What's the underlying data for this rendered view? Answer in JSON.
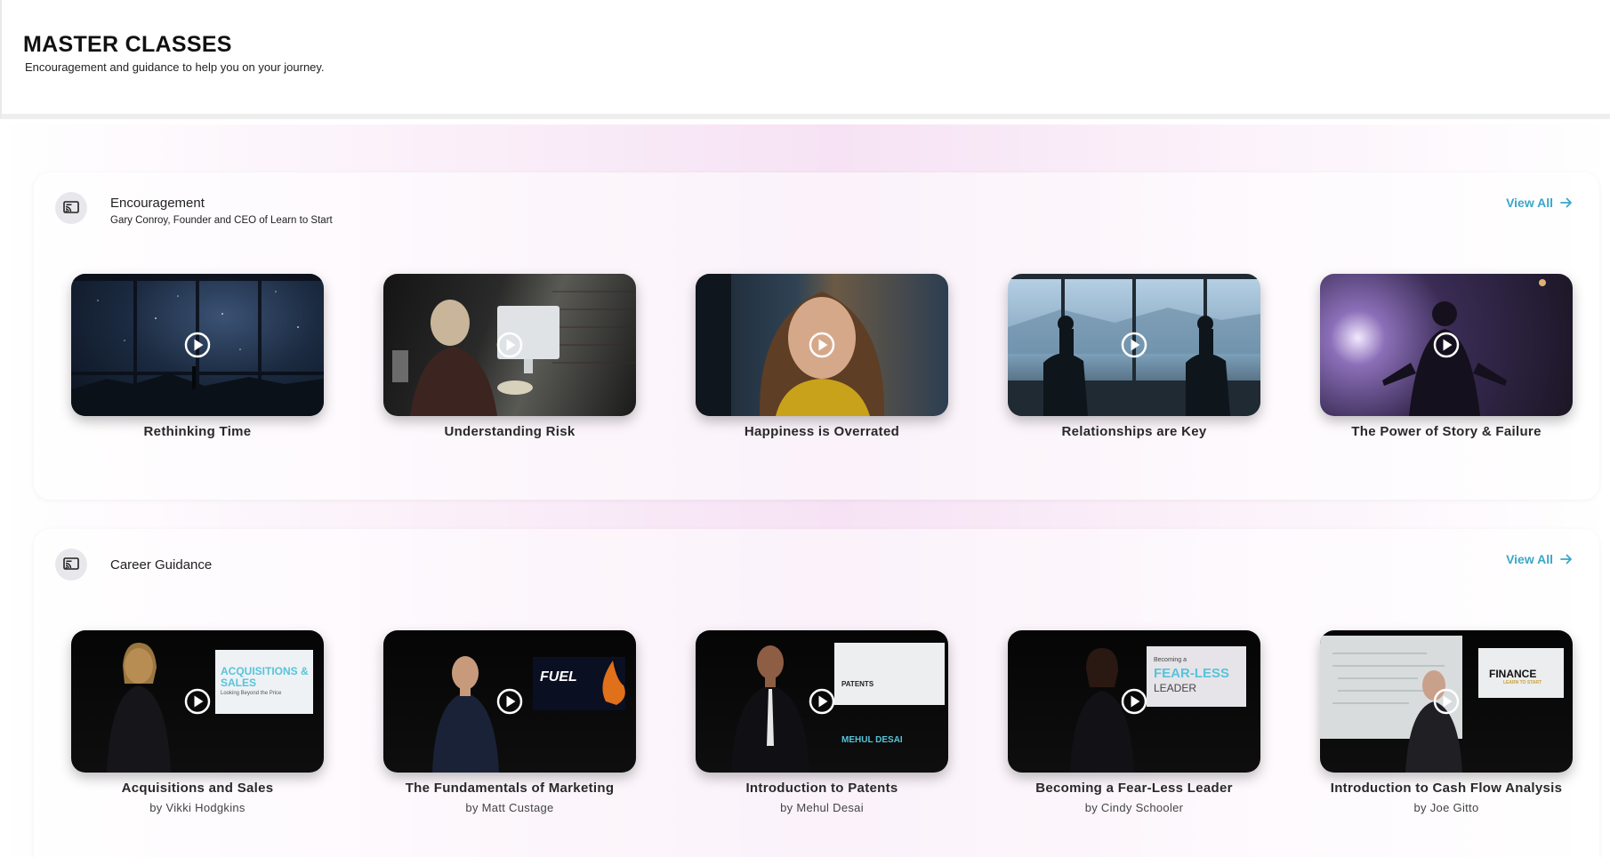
{
  "header": {
    "title": "MASTER CLASSES",
    "subtitle": "Encouragement and guidance to help you on your journey."
  },
  "sections": [
    {
      "icon": "cast-icon",
      "title": "Encouragement",
      "subtitle": "Gary Conroy, Founder and CEO of Learn to Start",
      "view_all": "View All",
      "cards": [
        {
          "title": "Rethinking Time"
        },
        {
          "title": "Understanding Risk"
        },
        {
          "title": "Happiness is Overrated"
        },
        {
          "title": "Relationships are Key"
        },
        {
          "title": "The Power of Story & Failure"
        }
      ]
    },
    {
      "icon": "cast-icon",
      "title": "Career Guidance",
      "view_all": "View All",
      "cards": [
        {
          "title": "Acquisitions and Sales",
          "author": "by Vikki Hodgkins",
          "screen_text": "ACQUISITIONS & SALES",
          "screen_sub": "Looking Beyond the Price"
        },
        {
          "title": "The Fundamentals of Marketing",
          "author": "by Matt Custage",
          "screen_text": "FUEL"
        },
        {
          "title": "Introduction to Patents",
          "author": "by Mehul Desai",
          "screen_text": "PATENTS",
          "screen_sub": "MEHUL DESAI"
        },
        {
          "title": "Becoming a Fear-Less Leader",
          "author": "by Cindy Schooler",
          "screen_pre": "Becoming a",
          "screen_text": "FEAR-LESS",
          "screen_sub": "LEADER"
        },
        {
          "title": "Introduction to Cash Flow Analysis",
          "author": "by Joe Gitto",
          "screen_text": "FINANCE",
          "screen_sub": "LEARN TO START"
        }
      ]
    }
  ],
  "colors": {
    "accent": "#3aa6c8",
    "background_tint": "#f6e2f4"
  }
}
